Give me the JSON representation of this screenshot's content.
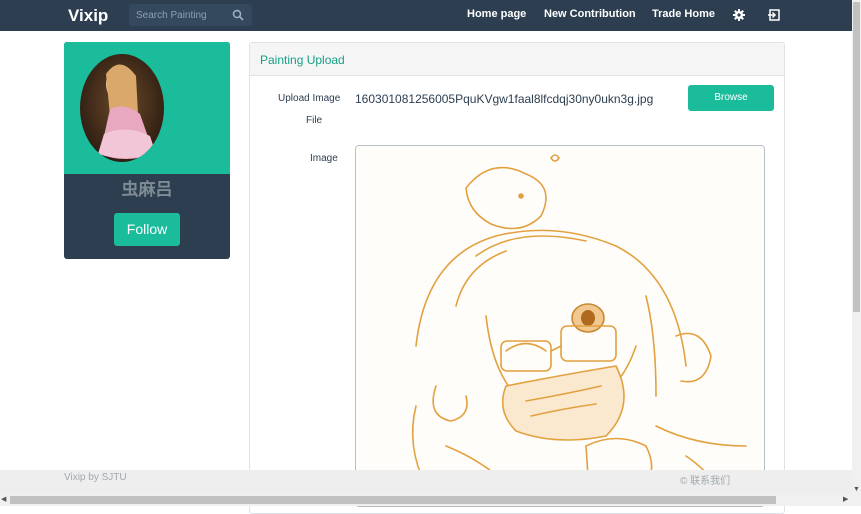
{
  "nav": {
    "brand": "Vixip",
    "search_placeholder": "Search Painting",
    "links": [
      "Home page",
      "New Contribution",
      "Trade Home"
    ],
    "settings_icon": "gear-icon",
    "logout_icon": "logout-icon"
  },
  "profile": {
    "username": "虫麻吕",
    "follow_label": "Follow"
  },
  "upload": {
    "title": "Painting Upload",
    "file_label_1": "Upload Image",
    "file_label_2": "File",
    "filename": "160301081256005PquKVgw1faal8lfcdqj30ny0ukn3g.jpg",
    "browse_label": "Browse",
    "image_label": "Image"
  },
  "footer": {
    "left": "Vixip by SJTU",
    "right": "© 联系我们"
  },
  "colors": {
    "navbar": "#2c3e50",
    "accent": "#1abc9c"
  }
}
